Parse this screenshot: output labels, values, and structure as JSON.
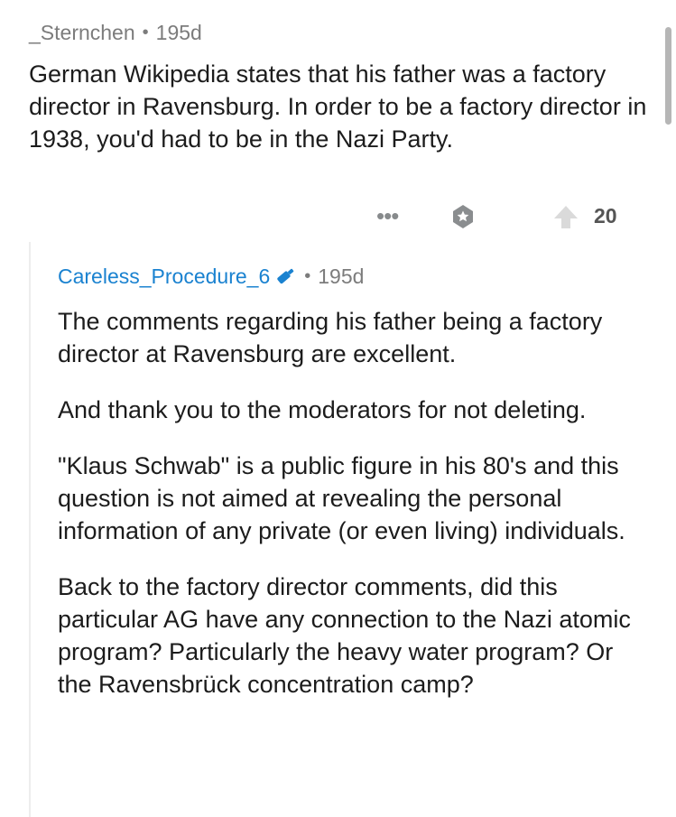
{
  "parent_comment": {
    "author": "_Sternchen",
    "separator": "•",
    "age": "195d",
    "body": "German Wikipedia states that his father was a factory director in Ravensburg. In order to be a factory director in 1938, you'd had to be in the Nazi Party.",
    "actions": {
      "more_label": "•••",
      "award_icon": "award-icon",
      "upvote_icon": "upvote-arrow-icon",
      "vote_count": "20"
    }
  },
  "reply_comment": {
    "author": "Careless_Procedure_6",
    "author_badge_icon": "moderator-shield-icon",
    "separator": "•",
    "age": "195d",
    "paragraphs": [
      "The comments regarding his father being a factory director at Ravensburg are excellent.",
      "And thank you to the moderators for not deleting.",
      "\"Klaus Schwab\" is a public figure in his 80's and this question is not aimed at revealing the personal information of any private (or even living) individuals.",
      "Back to the factory director comments, did this particular AG have any connection to the Nazi atomic program? Particularly the heavy water program? Or the Ravensbrück concentration camp?"
    ]
  },
  "colors": {
    "author_link": "#1a82d0",
    "meta_gray": "#7c7c7c",
    "icon_gray": "#878a8c",
    "thread_line": "#ededed"
  }
}
